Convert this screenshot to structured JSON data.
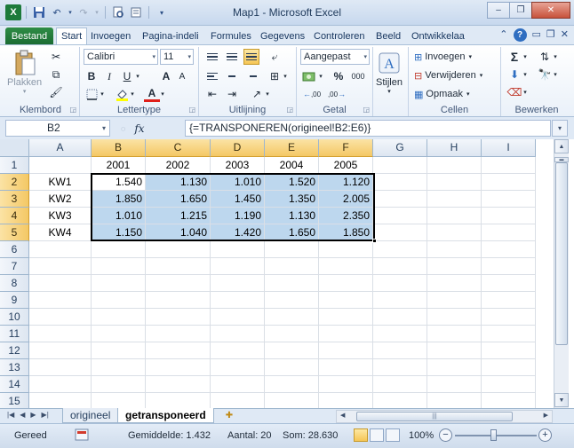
{
  "window": {
    "title": "Map1 - Microsoft Excel",
    "buttons": {
      "minimize": "–",
      "restore": "❐",
      "close": "✕"
    }
  },
  "qat": {
    "app_icon": "X",
    "save_icon": "floppy-icon",
    "undo_icon": "undo-icon",
    "redo_icon": "redo-icon"
  },
  "ribbon_tabs": [
    "Bestand",
    "Start",
    "Invoegen",
    "Pagina-indeli",
    "Formules",
    "Gegevens",
    "Controleren",
    "Beeld",
    "Ontwikkelaa"
  ],
  "active_tab": "Start",
  "ribbon": {
    "clipboard": {
      "label": "Klembord",
      "paste": "Plakken"
    },
    "font": {
      "label": "Lettertype",
      "name": "Calibri",
      "size": "11",
      "bold": "B",
      "italic": "I",
      "underline": "U",
      "grow": "A",
      "shrink": "A",
      "color_letter": "A"
    },
    "alignment": {
      "label": "Uitlijning"
    },
    "number": {
      "label": "Getal",
      "format": "Aangepast",
      "percent": "%",
      "thousands": "000",
      "dec_inc": ",00",
      "dec_dec": ",00"
    },
    "styles": {
      "label": "Stijlen"
    },
    "cells": {
      "label": "Cellen",
      "insert": "Invoegen",
      "delete": "Verwijderen",
      "format": "Opmaak"
    },
    "editing": {
      "label": "Bewerken",
      "sum": "Σ"
    }
  },
  "formula_bar": {
    "name_box": "B2",
    "fx": "fx",
    "formula": "{=TRANSPONEREN(origineel!B2:E6)}"
  },
  "grid": {
    "columns": [
      "A",
      "B",
      "C",
      "D",
      "E",
      "F",
      "G",
      "H",
      "I"
    ],
    "rows": [
      "1",
      "2",
      "3",
      "4",
      "5",
      "6",
      "7",
      "8",
      "9",
      "10",
      "11",
      "12",
      "13",
      "14",
      "15"
    ],
    "header_row": [
      "",
      "2001",
      "2002",
      "2003",
      "2004",
      "2005"
    ],
    "data": [
      [
        "KW1",
        "1.540",
        "1.130",
        "1.010",
        "1.520",
        "1.120"
      ],
      [
        "KW2",
        "1.850",
        "1.650",
        "1.450",
        "1.350",
        "2.005"
      ],
      [
        "KW3",
        "1.010",
        "1.215",
        "1.190",
        "1.130",
        "2.350"
      ],
      [
        "KW4",
        "1.150",
        "1.040",
        "1.420",
        "1.650",
        "1.850"
      ]
    ]
  },
  "sheet_tabs": [
    "origineel",
    "getransponeerd"
  ],
  "active_sheet": "getransponeerd",
  "status": {
    "mode": "Gereed",
    "average": "Gemiddelde: 1.432",
    "count": "Aantal: 20",
    "sum": "Som: 28.630",
    "zoom": "100%"
  },
  "colors": {
    "selection_fill": "#bdd7ee",
    "header_selected": "#f4c865",
    "file_tab": "#1f7235"
  }
}
